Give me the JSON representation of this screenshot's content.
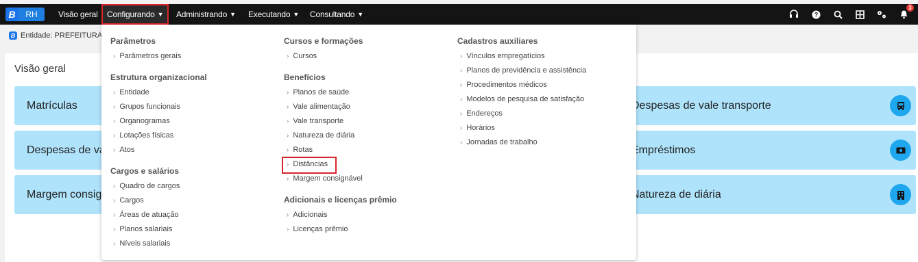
{
  "app": {
    "logo_letter": "B",
    "logo_text": "RH"
  },
  "nav": {
    "visao_geral": "Visão geral",
    "configurando": "Configurando",
    "administrando": "Administrando",
    "executando": "Executando",
    "consultando": "Consultando"
  },
  "notifications": {
    "count": "3"
  },
  "entity": "Entidade: PREFEITURA D",
  "main": {
    "title": "Visão geral",
    "cards": [
      {
        "left": "Matrículas",
        "right": "Despesas de vale transporte",
        "icon": "bus-icon"
      },
      {
        "left": "Despesas de val",
        "right": "Empréstimos",
        "icon": "money-icon"
      },
      {
        "left": "Margem consign",
        "right": "Natureza de diária",
        "icon": "building-icon"
      }
    ]
  },
  "menu": {
    "col1": [
      {
        "title": "Parâmetros",
        "items": [
          "Parâmetros gerais"
        ]
      },
      {
        "title": "Estrutura organizacional",
        "items": [
          "Entidade",
          "Grupos funcionais",
          "Organogramas",
          "Lotações físicas",
          "Atos"
        ]
      },
      {
        "title": "Cargos e salários",
        "items": [
          "Quadro de cargos",
          "Cargos",
          "Áreas de atuação",
          "Planos salariais",
          "Níveis salariais"
        ]
      }
    ],
    "col2": [
      {
        "title": "Cursos e formações",
        "items": [
          "Cursos"
        ]
      },
      {
        "title": "Benefícios",
        "items": [
          "Planos de saúde",
          "Vale alimentação",
          "Vale transporte",
          "Natureza de diária",
          "Rotas",
          "Distâncias",
          "Margem consignável"
        ]
      },
      {
        "title": "Adicionais e licenças prêmio",
        "items": [
          "Adicionais",
          "Licenças prêmio"
        ]
      }
    ],
    "col3": [
      {
        "title": "Cadastros auxiliares",
        "items": [
          "Vínculos empregatícios",
          "Planos de previdência e assistência",
          "Procedimentos médicos",
          "Modelos de pesquisa de satisfação",
          "Endereços",
          "Horários",
          "Jornadas de trabalho"
        ]
      }
    ]
  }
}
